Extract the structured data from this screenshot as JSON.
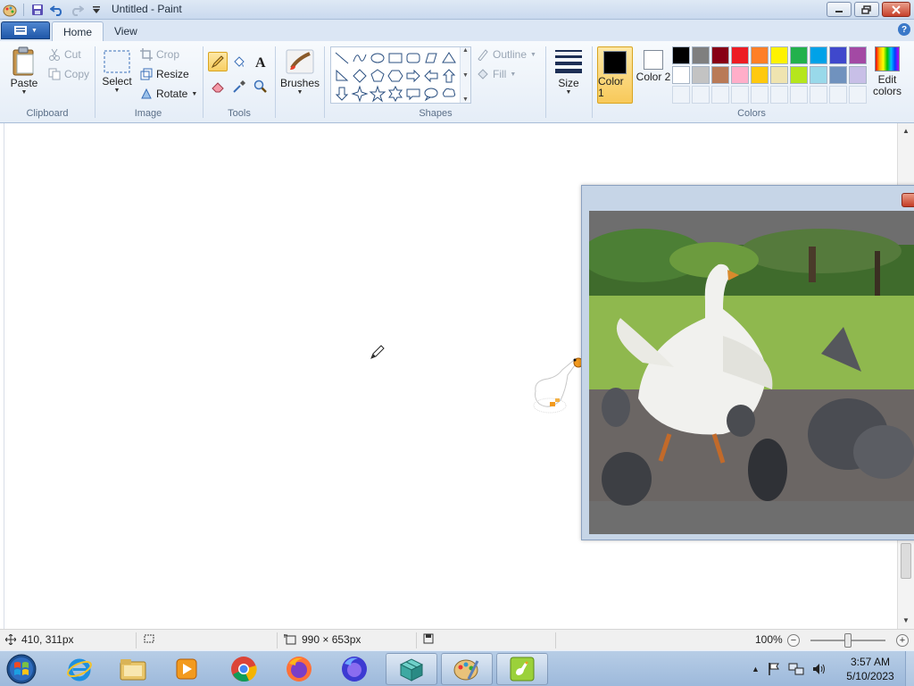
{
  "window": {
    "title": "Untitled - Paint"
  },
  "ribbon": {
    "tabs": [
      "Home",
      "View"
    ],
    "clipboard": {
      "group_label": "Clipboard",
      "paste": "Paste",
      "cut": "Cut",
      "copy": "Copy"
    },
    "image": {
      "group_label": "Image",
      "select": "Select",
      "crop": "Crop",
      "resize": "Resize",
      "rotate": "Rotate"
    },
    "tools": {
      "group_label": "Tools"
    },
    "brushes": {
      "label": "Brushes"
    },
    "shapes": {
      "group_label": "Shapes",
      "outline": "Outline",
      "fill": "Fill"
    },
    "size": {
      "label": "Size"
    },
    "colors": {
      "group_label": "Colors",
      "color1_label": "Color 1",
      "color2_label": "Color 2",
      "color1_value": "#000000",
      "color2_value": "#ffffff",
      "edit_colors": "Edit colors",
      "palette_row1": [
        "#000000",
        "#7f7f7f",
        "#880015",
        "#ed1c24",
        "#ff7f27",
        "#fff200",
        "#22b14c",
        "#00a2e8",
        "#3f48cc",
        "#a349a4"
      ],
      "palette_row2": [
        "#ffffff",
        "#c3c3c3",
        "#b97a57",
        "#ffaec9",
        "#ffc90e",
        "#efe4b0",
        "#b5e61d",
        "#99d9ea",
        "#7092be",
        "#c8bfe7"
      ]
    }
  },
  "status": {
    "cursor_pos": "410, 311px",
    "selection_size": "",
    "canvas_size": "990 × 653px",
    "zoom": "100%"
  },
  "taskbar": {
    "apps": [
      "start-icon",
      "internet-explorer-icon",
      "file-explorer-icon",
      "media-player-icon",
      "chrome-icon",
      "firefox-icon",
      "firefox-nightly-icon",
      "package-icon",
      "paint-icon",
      "goose-icon"
    ],
    "time": "3:57 AM",
    "date": "5/10/2023"
  }
}
